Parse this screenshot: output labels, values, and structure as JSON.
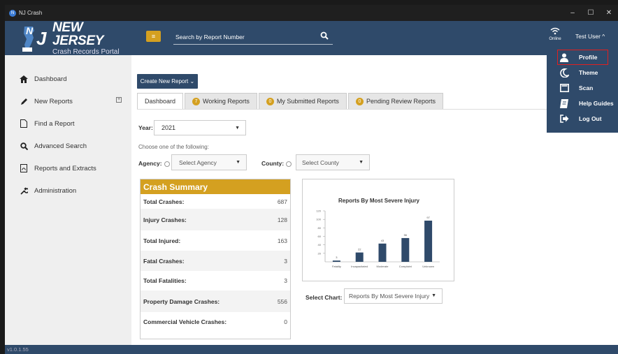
{
  "window": {
    "title": "NJ Crash",
    "buttons": {
      "minimize": "–",
      "maximize": "☐",
      "close": "✕"
    }
  },
  "logo": {
    "line1": "NEW JERSEY",
    "line2": "Crash Records Portal"
  },
  "sidebar": {
    "items": [
      {
        "label": "Dashboard",
        "icon": "home-icon"
      },
      {
        "label": "New Reports",
        "icon": "pencil-icon",
        "expand": "+"
      },
      {
        "label": "Find a Report",
        "icon": "document-icon"
      },
      {
        "label": "Advanced Search",
        "icon": "search-icon"
      },
      {
        "label": "Reports and Extracts",
        "icon": "pdf-icon"
      },
      {
        "label": "Administration",
        "icon": "wrench-icon"
      }
    ]
  },
  "topbar": {
    "menu_icon": "≡",
    "search_placeholder": "Search by Report Number",
    "status": "Online",
    "user": "Test User  ^"
  },
  "user_menu": {
    "items": [
      {
        "label": "Profile",
        "icon": "person-icon"
      },
      {
        "label": "Theme",
        "icon": "moon-icon"
      },
      {
        "label": "Scan",
        "icon": "scanner-icon"
      },
      {
        "label": "Help Guides",
        "icon": "book-icon"
      },
      {
        "label": "Log Out",
        "icon": "logout-icon"
      }
    ]
  },
  "main": {
    "create_button": "Create New Report ⌄",
    "tabs": [
      {
        "label": "Dashboard",
        "badge": ""
      },
      {
        "label": "Working Reports",
        "badge": "7"
      },
      {
        "label": "My Submitted Reports",
        "badge": "0"
      },
      {
        "label": "Pending Review Reports",
        "badge": "0"
      }
    ],
    "year_label": "Year:",
    "year_value": "2021",
    "choose_text": "Choose one of the following:",
    "agency_label": "Agency:",
    "agency_placeholder": "Select Agency",
    "county_label": "County:",
    "county_placeholder": "Select County",
    "select_chart_label": "Select Chart:",
    "select_chart_value": "Reports By Most Severe Injury"
  },
  "summary": {
    "title": "Crash Summary",
    "rows": [
      {
        "label": "Total Crashes:",
        "value": "687"
      },
      {
        "label": "Injury Crashes:",
        "value": "128"
      },
      {
        "label": "Total Injured:",
        "value": "163"
      },
      {
        "label": "Fatal Crashes:",
        "value": "3"
      },
      {
        "label": "Total Fatalities:",
        "value": "3"
      },
      {
        "label": "Property Damage Crashes:",
        "value": "556"
      },
      {
        "label": "Commercial Vehicle Crashes:",
        "value": "0"
      }
    ]
  },
  "chart_data": {
    "type": "bar",
    "title": "Reports By Most Severe Injury",
    "categories": [
      "Fatality",
      "Incapacitated",
      "Moderate",
      "Complaint",
      "Unknown"
    ],
    "values": [
      3,
      22,
      43,
      56,
      97
    ],
    "ylim": [
      0,
      120
    ],
    "yticks": [
      20,
      40,
      60,
      80,
      100,
      120
    ],
    "colors": {
      "bar": "#2f4a6a"
    }
  },
  "footer": {
    "version": "v1.0.1.55"
  },
  "colors": {
    "navy": "#2f4a6a",
    "gold": "#d4a020"
  }
}
